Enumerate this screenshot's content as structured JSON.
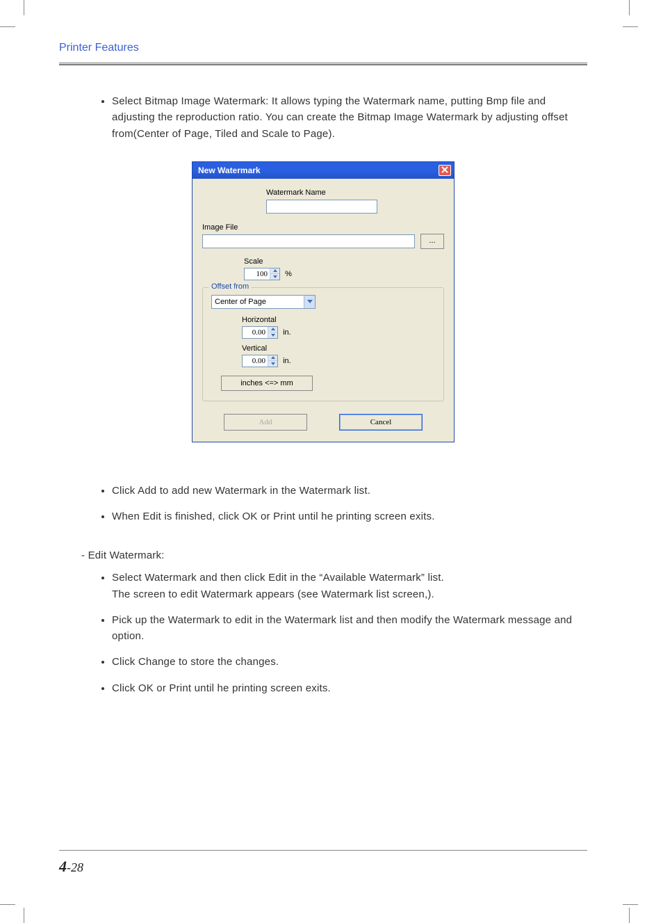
{
  "header": {
    "title": "Printer Features"
  },
  "intro_bullet": "Select Bitmap Image Watermark: It allows typing the Watermark name, putting Bmp file and adjusting the reproduction ratio. You can create the Bitmap Image Watermark by adjusting offset from(Center of Page, Tiled and Scale to Page).",
  "dialog": {
    "title": "New Watermark",
    "watermark_name_label": "Watermark Name",
    "watermark_name_value": "",
    "image_file_label": "Image File",
    "image_file_value": "",
    "browse_label": "...",
    "scale_label": "Scale",
    "scale_value": "100",
    "scale_unit": "%",
    "offset_group": "Offset from",
    "offset_select": "Center of Page",
    "horizontal_label": "Horizontal",
    "horizontal_value": "0.00",
    "horizontal_unit": "in.",
    "vertical_label": "Vertical",
    "vertical_value": "0.00",
    "vertical_unit": "in.",
    "units_button": "inches <=> mm",
    "add_button": "Add",
    "cancel_button": "Cancel"
  },
  "after_bullets": [
    "Click Add to add new Watermark in the Watermark list.",
    "When Edit is finished, click OK or Print until he printing screen exits."
  ],
  "edit_section": {
    "heading": "- Edit Watermark:",
    "bullets": [
      "Select Watermark and then click Edit in the “Available Watermark” list.\nThe screen to edit Watermark appears (see Watermark list screen,).",
      "Pick up the Watermark to edit in the Watermark list and then modify the Watermark message and option.",
      "Click Change to store the changes.",
      "Click OK or Print until he printing screen exits."
    ]
  },
  "footer": {
    "chapter": "4",
    "sep": "-",
    "page": "28"
  }
}
